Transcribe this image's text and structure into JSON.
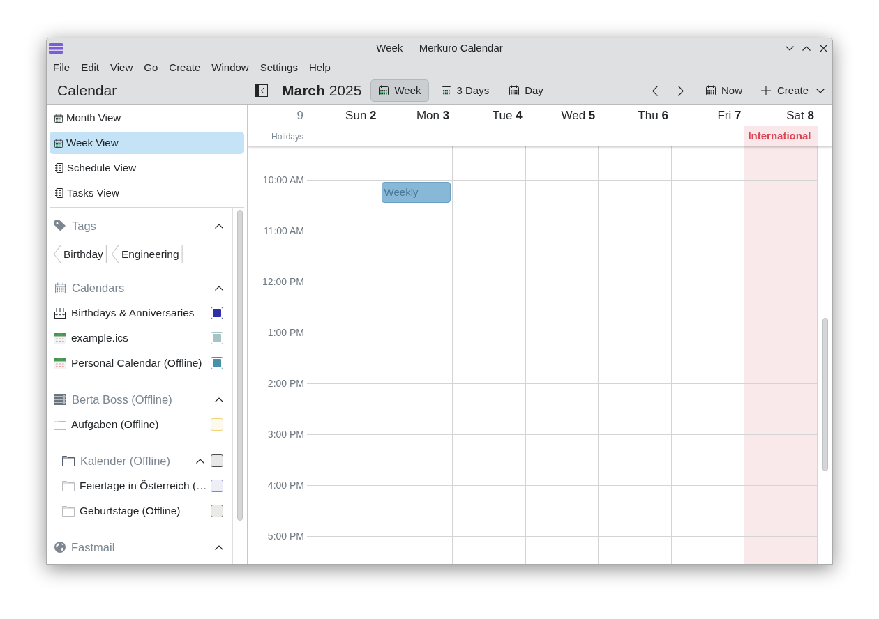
{
  "window": {
    "title": "Week — Merkuro Calendar"
  },
  "menu_bar": [
    "File",
    "Edit",
    "View",
    "Go",
    "Create",
    "Window",
    "Settings",
    "Help"
  ],
  "toolbar": {
    "title": "Calendar",
    "heading": "**March** 2025",
    "views": [
      {
        "label": "Week",
        "selected": true
      },
      {
        "label": "3 Days",
        "selected": false
      },
      {
        "label": "Day",
        "selected": false
      }
    ],
    "now": "Now",
    "create": "Create"
  },
  "sidebar": {
    "views": [
      {
        "label": "Month View",
        "kind": "calendar",
        "selected": false
      },
      {
        "label": "Week View",
        "kind": "calendar",
        "selected": true
      },
      {
        "label": "Schedule View",
        "kind": "list",
        "selected": false
      },
      {
        "label": "Tasks View",
        "kind": "list",
        "selected": false
      }
    ],
    "sections": [
      {
        "kind": "tags",
        "title": "Tags",
        "expanded": true,
        "tags": [
          "Birthday",
          "Engineering"
        ]
      },
      {
        "kind": "calendars",
        "title": "Calendars",
        "expanded": true,
        "items": [
          {
            "name": "Birthdays & Anniversaries",
            "kind": "birthdays",
            "color": "#2f2fa8",
            "checked": true
          },
          {
            "name": "example.ics",
            "kind": "calendar",
            "color": "#a6c4c4",
            "checked": true
          },
          {
            "name": "Personal Calendar (Offline)",
            "kind": "calendar",
            "color": "#4a90a8",
            "checked": true
          }
        ]
      },
      {
        "kind": "server",
        "title": "Berta Boss (Offline)",
        "expanded": true,
        "items": [
          {
            "name": "Aufgaben (Offline)",
            "kind": "folder",
            "color": "#f2d37a",
            "checked": false
          },
          {
            "name": "Kalender (Offline)",
            "kind": "folder",
            "color": "#4d4d4d",
            "checked": false,
            "expanded": true,
            "children": [
              {
                "name": "Feiertage in Österreich (…",
                "kind": "folder",
                "color": "#8080d4",
                "checked": false
              },
              {
                "name": "Geburtstage (Offline)",
                "kind": "folder",
                "color": "#5e5e4c",
                "checked": false
              }
            ]
          }
        ]
      },
      {
        "kind": "web",
        "title": "Fastmail",
        "expanded": true
      }
    ]
  },
  "week_view": {
    "week_number": "9",
    "all_day_label": "Holidays",
    "days": [
      {
        "name": "Sun",
        "date": "2",
        "holiday": false
      },
      {
        "name": "Mon",
        "date": "3",
        "holiday": false,
        "events": [
          {
            "title": "Weekly"
          }
        ]
      },
      {
        "name": "Tue",
        "date": "4",
        "holiday": false
      },
      {
        "name": "Wed",
        "date": "5",
        "holiday": false
      },
      {
        "name": "Thu",
        "date": "6",
        "holiday": false
      },
      {
        "name": "Fri",
        "date": "7",
        "holiday": false
      },
      {
        "name": "Sat",
        "date": "8",
        "holiday": true,
        "all_day_events": [
          {
            "title": "International",
            "color": "#da4453"
          }
        ]
      }
    ],
    "hours": [
      "10:00 AM",
      "11:00 AM",
      "12:00 PM",
      "1:00 PM",
      "2:00 PM",
      "3:00 PM",
      "4:00 PM",
      "5:00 PM"
    ]
  }
}
